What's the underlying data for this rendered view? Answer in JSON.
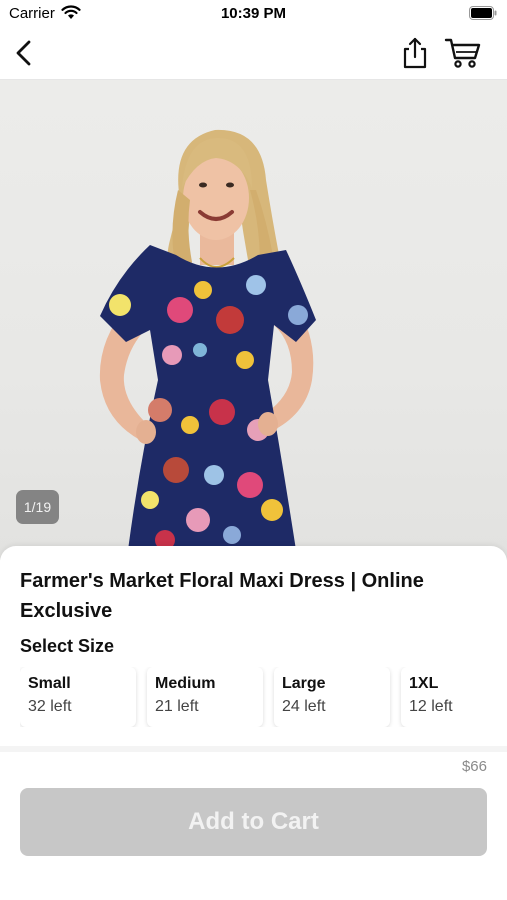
{
  "status": {
    "carrier": "Carrier",
    "time": "10:39 PM"
  },
  "nav": {
    "back_icon": "chevron-left-icon",
    "share_icon": "share-icon",
    "cart_icon": "cart-icon"
  },
  "gallery": {
    "counter": "1/19"
  },
  "product": {
    "title": "Farmer's Market Floral Maxi Dress | Online Exclusive",
    "select_size_label": "Select Size",
    "sizes": [
      {
        "name": "Small",
        "stock": "32 left"
      },
      {
        "name": "Medium",
        "stock": "21 left"
      },
      {
        "name": "Large",
        "stock": "24 left"
      },
      {
        "name": "1XL",
        "stock": "12 left"
      }
    ],
    "price": "$66",
    "add_to_cart_label": "Add to Cart"
  },
  "colors": {
    "button_disabled": "#c7c7c7",
    "dress_navy": "#1e2a66"
  }
}
